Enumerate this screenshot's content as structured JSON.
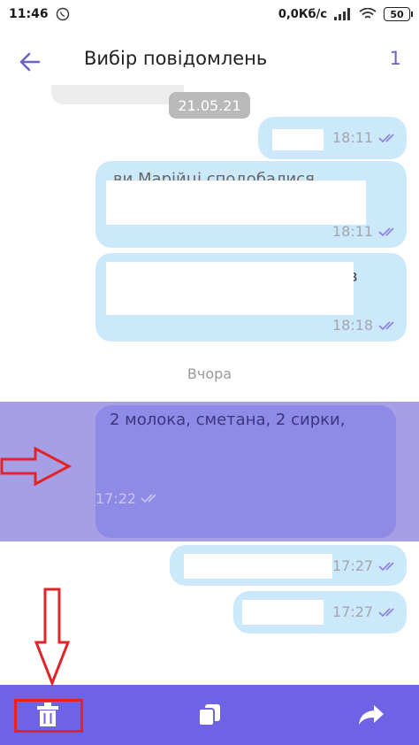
{
  "status_bar": {
    "time": "11:46",
    "network_speed": "0,0Кб/с",
    "battery": "50"
  },
  "header": {
    "title": "Вибір повідомлень",
    "selected_count": "1"
  },
  "chat": {
    "date_separator": "21.05.21",
    "day_separator": "Вчора",
    "messages": [
      {
        "time": "18:11",
        "preview": "",
        "selected": false
      },
      {
        "time": "18:11",
        "preview": "ви Марійці сподобалися",
        "selected": false
      },
      {
        "time": "18:18",
        "preview": "в",
        "selected": false
      },
      {
        "time": "17:22",
        "preview": "2 молока, сметана, 2 сирки,",
        "selected": true
      },
      {
        "time": "17:27",
        "preview": "",
        "selected": false
      },
      {
        "time": "17:27",
        "preview": "",
        "selected": false
      }
    ]
  },
  "toolbar": {
    "delete_icon": "trash-icon",
    "copy_icon": "copy-icon",
    "forward_icon": "forward-icon"
  },
  "colors": {
    "accent": "#7062e4",
    "bubble": "#cce8fb",
    "selected_band": "#a79fe5",
    "selected_bubble": "#8f8ae6",
    "annotation": "#e0242a"
  }
}
